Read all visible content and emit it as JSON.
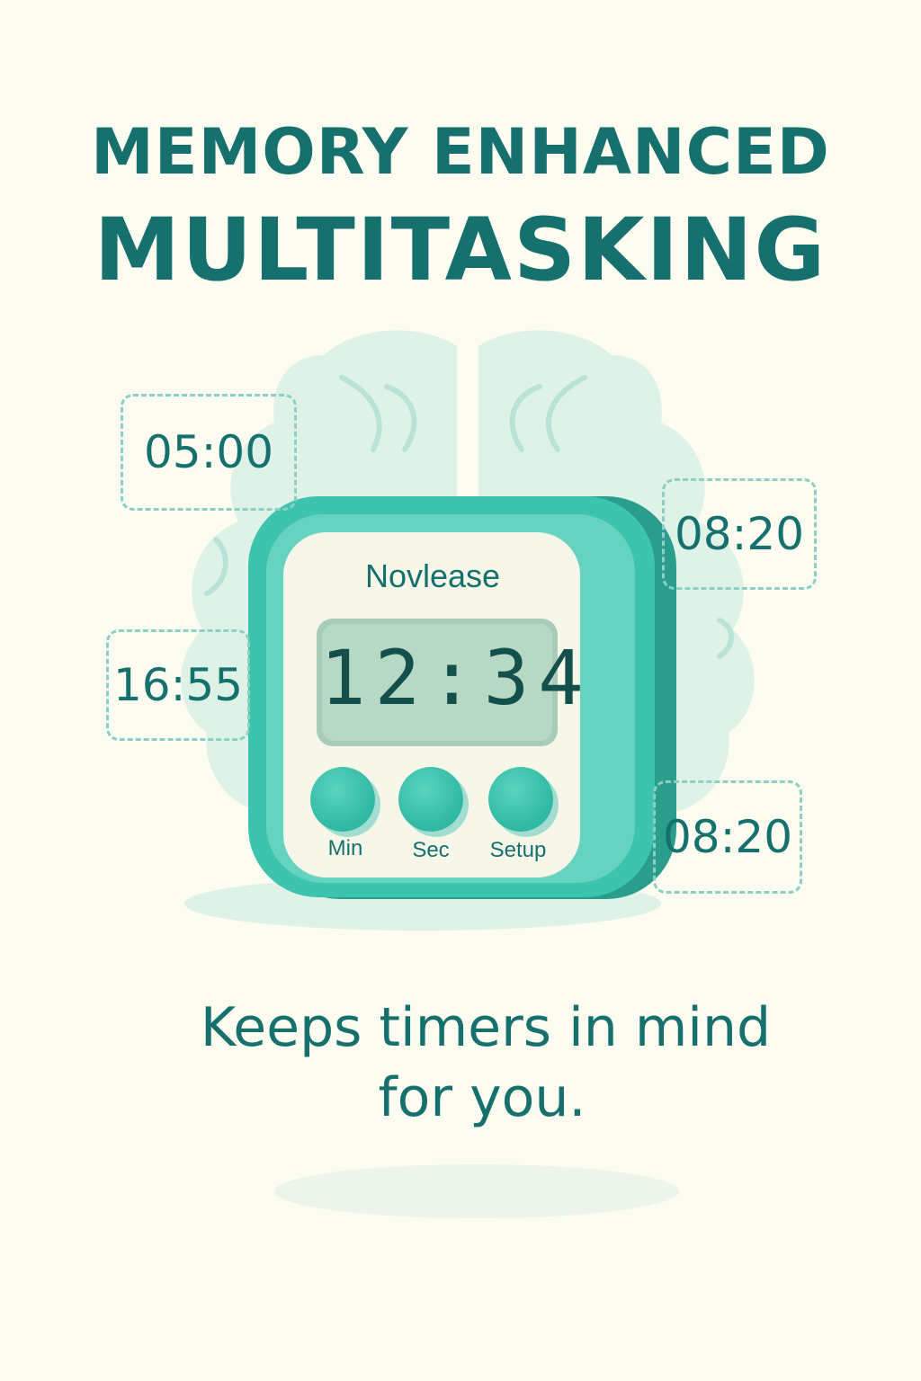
{
  "headline": {
    "line1": "MEMORY ENHANCED",
    "line2": "MULTITASKING"
  },
  "timer_device": {
    "brand": "Novlease",
    "display": "12:34",
    "buttons": {
      "min": "Min",
      "sec": "Sec",
      "setup": "Setup"
    }
  },
  "floating_timers": [
    "05:00",
    "08:20",
    "16:55",
    "08:20"
  ],
  "tagline": {
    "line1": "Keeps timers in mind",
    "line2": "for you."
  },
  "colors": {
    "background": "#fcfcf0",
    "text_teal": "#16706e",
    "device_teal": "#3cc4ae",
    "brain_mint": "#dff2e8",
    "lcd_green": "#b7d8c5"
  },
  "icons": [
    "brain-icon"
  ]
}
